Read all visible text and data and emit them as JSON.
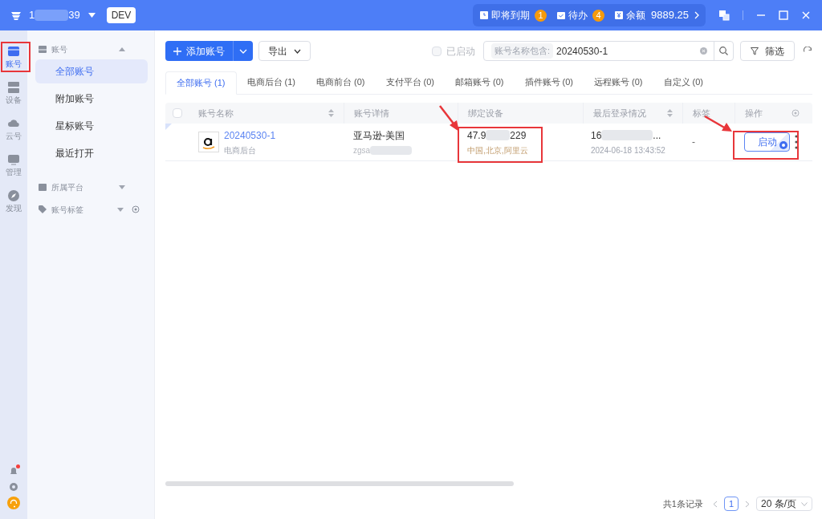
{
  "title_bar": {
    "user_start": "1",
    "user_end": "39",
    "env_badge": "DEV",
    "notices": [
      {
        "kind": "expire",
        "label": "即将到期",
        "count": "1"
      },
      {
        "kind": "todo",
        "label": "待办",
        "count": "4"
      },
      {
        "kind": "balance",
        "label": "余额",
        "value": "9889.25"
      }
    ]
  },
  "nav_rail": [
    {
      "label": "账号",
      "selected": true
    },
    {
      "label": "设备",
      "selected": false
    },
    {
      "label": "云号",
      "selected": false
    },
    {
      "label": "管理",
      "selected": false
    },
    {
      "label": "发现",
      "selected": false
    }
  ],
  "sidebar": {
    "section": {
      "label": "账号",
      "expanded": true
    },
    "items": [
      {
        "label": "全部账号",
        "selected": true
      },
      {
        "label": "附加账号",
        "selected": false
      },
      {
        "label": "星标账号",
        "selected": false
      },
      {
        "label": "最近打开",
        "selected": false
      }
    ],
    "groups": [
      {
        "label": "所属平台",
        "kind": "platform"
      },
      {
        "label": "账号标签",
        "kind": "tags"
      }
    ]
  },
  "toolbar": {
    "add_button": "添加账号",
    "export_button": "导出",
    "started_filter": {
      "label": "已启动",
      "checked": false
    },
    "search": {
      "prefix": "账号名称包含:",
      "value": "20240530-1"
    },
    "filter_button": "筛选"
  },
  "tabs": [
    {
      "label": "全部账号 (1)",
      "selected": true
    },
    {
      "label": "电商后台 (1)",
      "selected": false
    },
    {
      "label": "电商前台 (0)",
      "selected": false
    },
    {
      "label": "支付平台 (0)",
      "selected": false
    },
    {
      "label": "邮箱账号 (0)",
      "selected": false
    },
    {
      "label": "插件账号 (0)",
      "selected": false
    },
    {
      "label": "远程账号 (0)",
      "selected": false
    },
    {
      "label": "自定义 (0)",
      "selected": false
    }
  ],
  "table": {
    "select_all_checked": false,
    "columns": [
      {
        "label": "账号名称",
        "sortable": true
      },
      {
        "label": "账号详情",
        "sortable": false
      },
      {
        "label": "绑定设备",
        "sortable": false
      },
      {
        "label": "最后登录情况",
        "sortable": true
      },
      {
        "label": "标签",
        "sortable": false
      },
      {
        "label": "操作",
        "sortable": false
      }
    ],
    "rows": [
      {
        "name": "20240530-1",
        "category": "电商后台",
        "platform": "亚马逊-美国",
        "detail_start": "zgsa",
        "device_start": "47.9",
        "device_end": "229",
        "device_location": "中国,北京,阿里云",
        "login_start": "16",
        "login_end": "...",
        "login_time": "2024-06-18 13:43:52",
        "tag": "-",
        "action": "启动"
      }
    ]
  },
  "footer": {
    "total": "共1条记录",
    "pages": [
      {
        "label": "1",
        "selected": true
      }
    ],
    "page_size": "20 条/页"
  }
}
